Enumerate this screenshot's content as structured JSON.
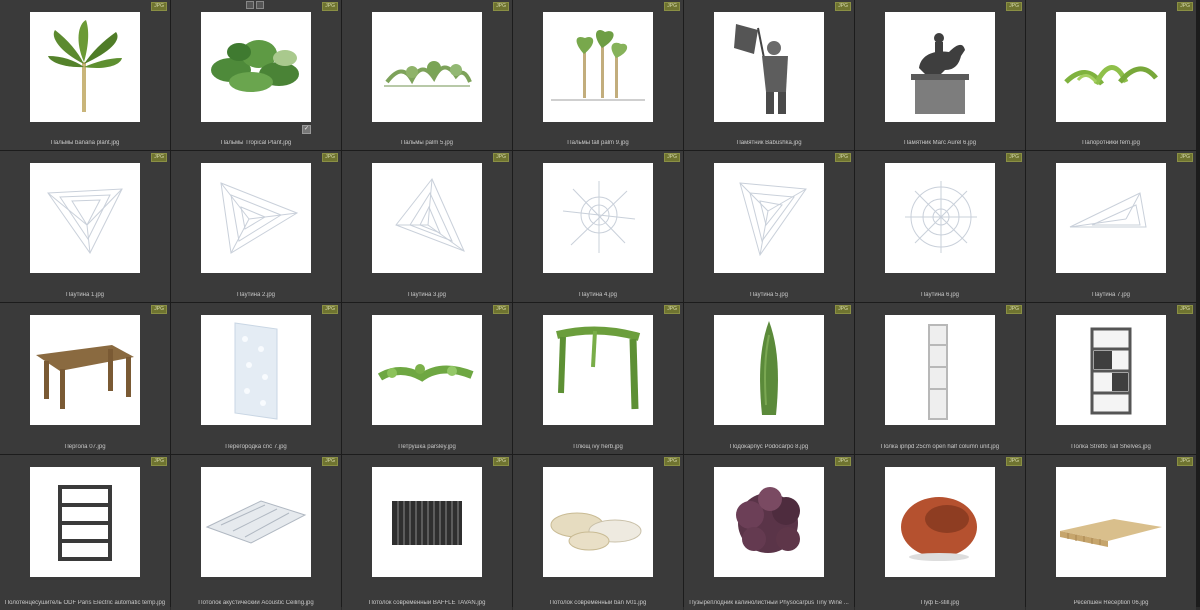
{
  "badge_text": "JPG",
  "check_glyph": "✓",
  "items": [
    {
      "label": "Пальмы banana plant.jpg",
      "icon": "banana-plant"
    },
    {
      "label": "Пальмы Tropical Plant.jpg",
      "icon": "tropical-plant"
    },
    {
      "label": "Пальмы palm 5.jpg",
      "icon": "palm-small"
    },
    {
      "label": "Пальмы tall palm 9.jpg",
      "icon": "palm-tall"
    },
    {
      "label": "Памятник Babushka.jpg",
      "icon": "statue-flag"
    },
    {
      "label": "Памятник Marc Aurel 6.jpg",
      "icon": "statue-horse"
    },
    {
      "label": "Папоротники fern.jpg",
      "icon": "fern"
    },
    {
      "label": "Паутина 1.jpg",
      "icon": "cobweb"
    },
    {
      "label": "Паутина 2.jpg",
      "icon": "cobweb"
    },
    {
      "label": "Паутина 3.jpg",
      "icon": "cobweb"
    },
    {
      "label": "Паутина 4.jpg",
      "icon": "cobweb"
    },
    {
      "label": "Паутина 5.jpg",
      "icon": "cobweb"
    },
    {
      "label": "Паутина 6.jpg",
      "icon": "cobweb"
    },
    {
      "label": "Паутина 7.jpg",
      "icon": "cobweb"
    },
    {
      "label": "Пергола 07.jpg",
      "icon": "pergola"
    },
    {
      "label": "Перегородка cnc 7.jpg",
      "icon": "cnc-partition"
    },
    {
      "label": "Петрушка parsley.jpg",
      "icon": "parsley"
    },
    {
      "label": "Плющ ivy herb.jpg",
      "icon": "ivy-arch"
    },
    {
      "label": "Подокарпус Podocarpo 8.jpg",
      "icon": "podocarpus"
    },
    {
      "label": "Полка ipnpd 25cm open half column unit.jpg",
      "icon": "shelf-column"
    },
    {
      "label": "Полка Stretto Tall Shelves.jpg",
      "icon": "shelf-tall"
    },
    {
      "label": "Полотенцесушитель ODF Paris Electric automatic temp.jpg",
      "icon": "towel-rail"
    },
    {
      "label": "Потолок акустический Acoustic Ceiling.jpg",
      "icon": "acoustic-ceiling"
    },
    {
      "label": "Потолок современный BAFFLE TAVAN.jpg",
      "icon": "baffle-ceiling"
    },
    {
      "label": "Потолок современный ban lv01.jpg",
      "icon": "ceiling-discs"
    },
    {
      "label": "Пузыреплодник калинолистный Physocarpus Tiny Wine ...",
      "icon": "shrub-wine"
    },
    {
      "label": "Пуф E-still.jpg",
      "icon": "pouf"
    },
    {
      "label": "Ресепшен Reception 06.jpg",
      "icon": "reception-desk"
    }
  ]
}
